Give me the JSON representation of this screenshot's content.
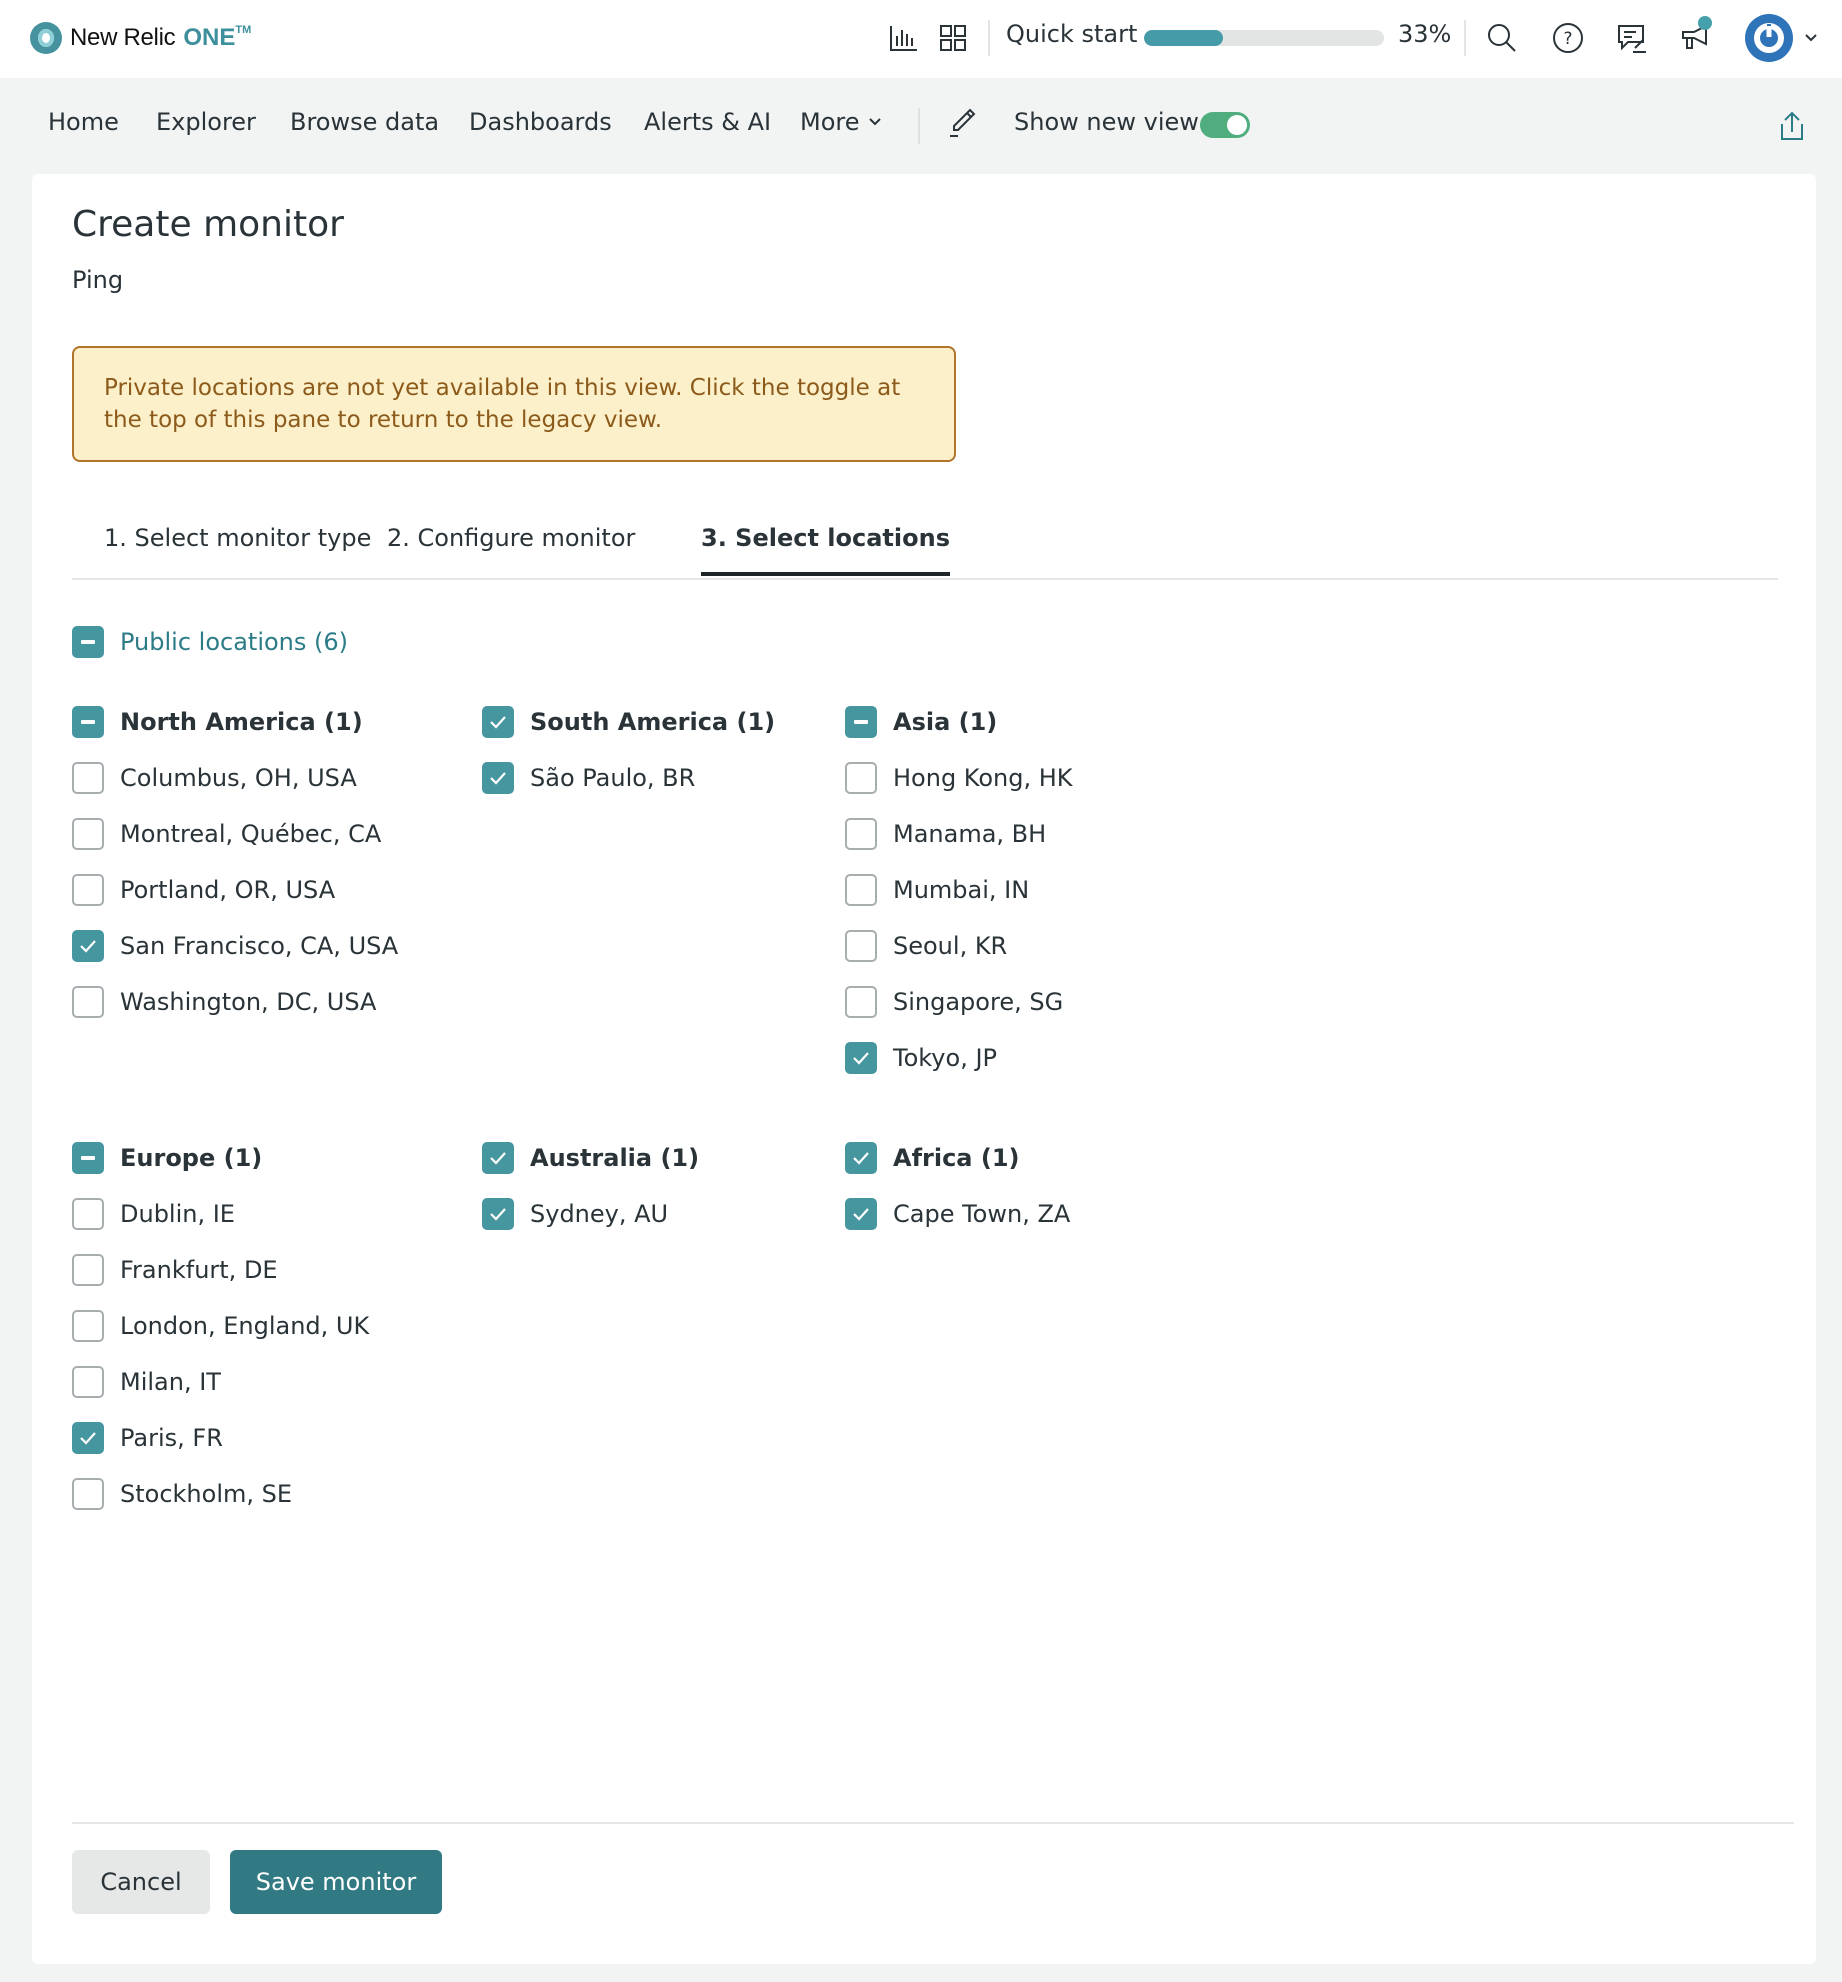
{
  "app": {
    "logo_text": "New Relic",
    "logo_brand": "ONE",
    "logo_tm": "TM"
  },
  "topbar": {
    "icons": [
      "bar-chart-icon",
      "apps-grid-icon",
      "search-icon",
      "help-icon",
      "feedback-icon",
      "megaphone-icon",
      "user-avatar",
      "chevron-down-icon"
    ],
    "quick_start_label": "Quick start",
    "quick_start_progress": 0.33,
    "quick_start_percent": "33%",
    "accent_color": "#459ba8"
  },
  "nav": {
    "items": [
      "Home",
      "Explorer",
      "Browse data",
      "Dashboards",
      "Alerts & AI",
      "More"
    ],
    "show_new_view_label": "Show new view",
    "show_new_view_on": true
  },
  "page": {
    "title": "Create monitor",
    "subtitle": "Ping",
    "warning": "Private locations are not yet available in this view.  Click the toggle at the top of this pane to return to the legacy view.",
    "tabs": [
      {
        "label": "1. Select monitor type",
        "active": false
      },
      {
        "label": "2. Configure monitor",
        "active": false
      },
      {
        "label": "3. Select locations",
        "active": true
      }
    ]
  },
  "locations": {
    "public_label": "Public locations (6)",
    "public_state": "partial",
    "groups": [
      {
        "label": "North America (1)",
        "state": "partial",
        "items": [
          {
            "label": "Columbus, OH, USA",
            "checked": false
          },
          {
            "label": "Montreal, Québec, CA",
            "checked": false
          },
          {
            "label": "Portland, OR, USA",
            "checked": false
          },
          {
            "label": "San Francisco, CA, USA",
            "checked": true
          },
          {
            "label": "Washington, DC, USA",
            "checked": false
          }
        ]
      },
      {
        "label": "South America (1)",
        "state": "checked",
        "items": [
          {
            "label": "São Paulo, BR",
            "checked": true
          }
        ]
      },
      {
        "label": "Asia (1)",
        "state": "partial",
        "items": [
          {
            "label": "Hong Kong, HK",
            "checked": false
          },
          {
            "label": "Manama, BH",
            "checked": false
          },
          {
            "label": "Mumbai, IN",
            "checked": false
          },
          {
            "label": "Seoul, KR",
            "checked": false
          },
          {
            "label": "Singapore, SG",
            "checked": false
          },
          {
            "label": "Tokyo, JP",
            "checked": true
          }
        ]
      },
      {
        "label": "Europe (1)",
        "state": "partial",
        "items": [
          {
            "label": "Dublin, IE",
            "checked": false
          },
          {
            "label": "Frankfurt, DE",
            "checked": false
          },
          {
            "label": "London, England, UK",
            "checked": false
          },
          {
            "label": "Milan, IT",
            "checked": false
          },
          {
            "label": "Paris, FR",
            "checked": true
          },
          {
            "label": "Stockholm, SE",
            "checked": false
          }
        ]
      },
      {
        "label": "Australia (1)",
        "state": "checked",
        "items": [
          {
            "label": "Sydney, AU",
            "checked": true
          }
        ]
      },
      {
        "label": "Africa (1)",
        "state": "checked",
        "items": [
          {
            "label": "Cape Town, ZA",
            "checked": true
          }
        ]
      }
    ]
  },
  "footer": {
    "cancel_label": "Cancel",
    "save_label": "Save monitor"
  }
}
